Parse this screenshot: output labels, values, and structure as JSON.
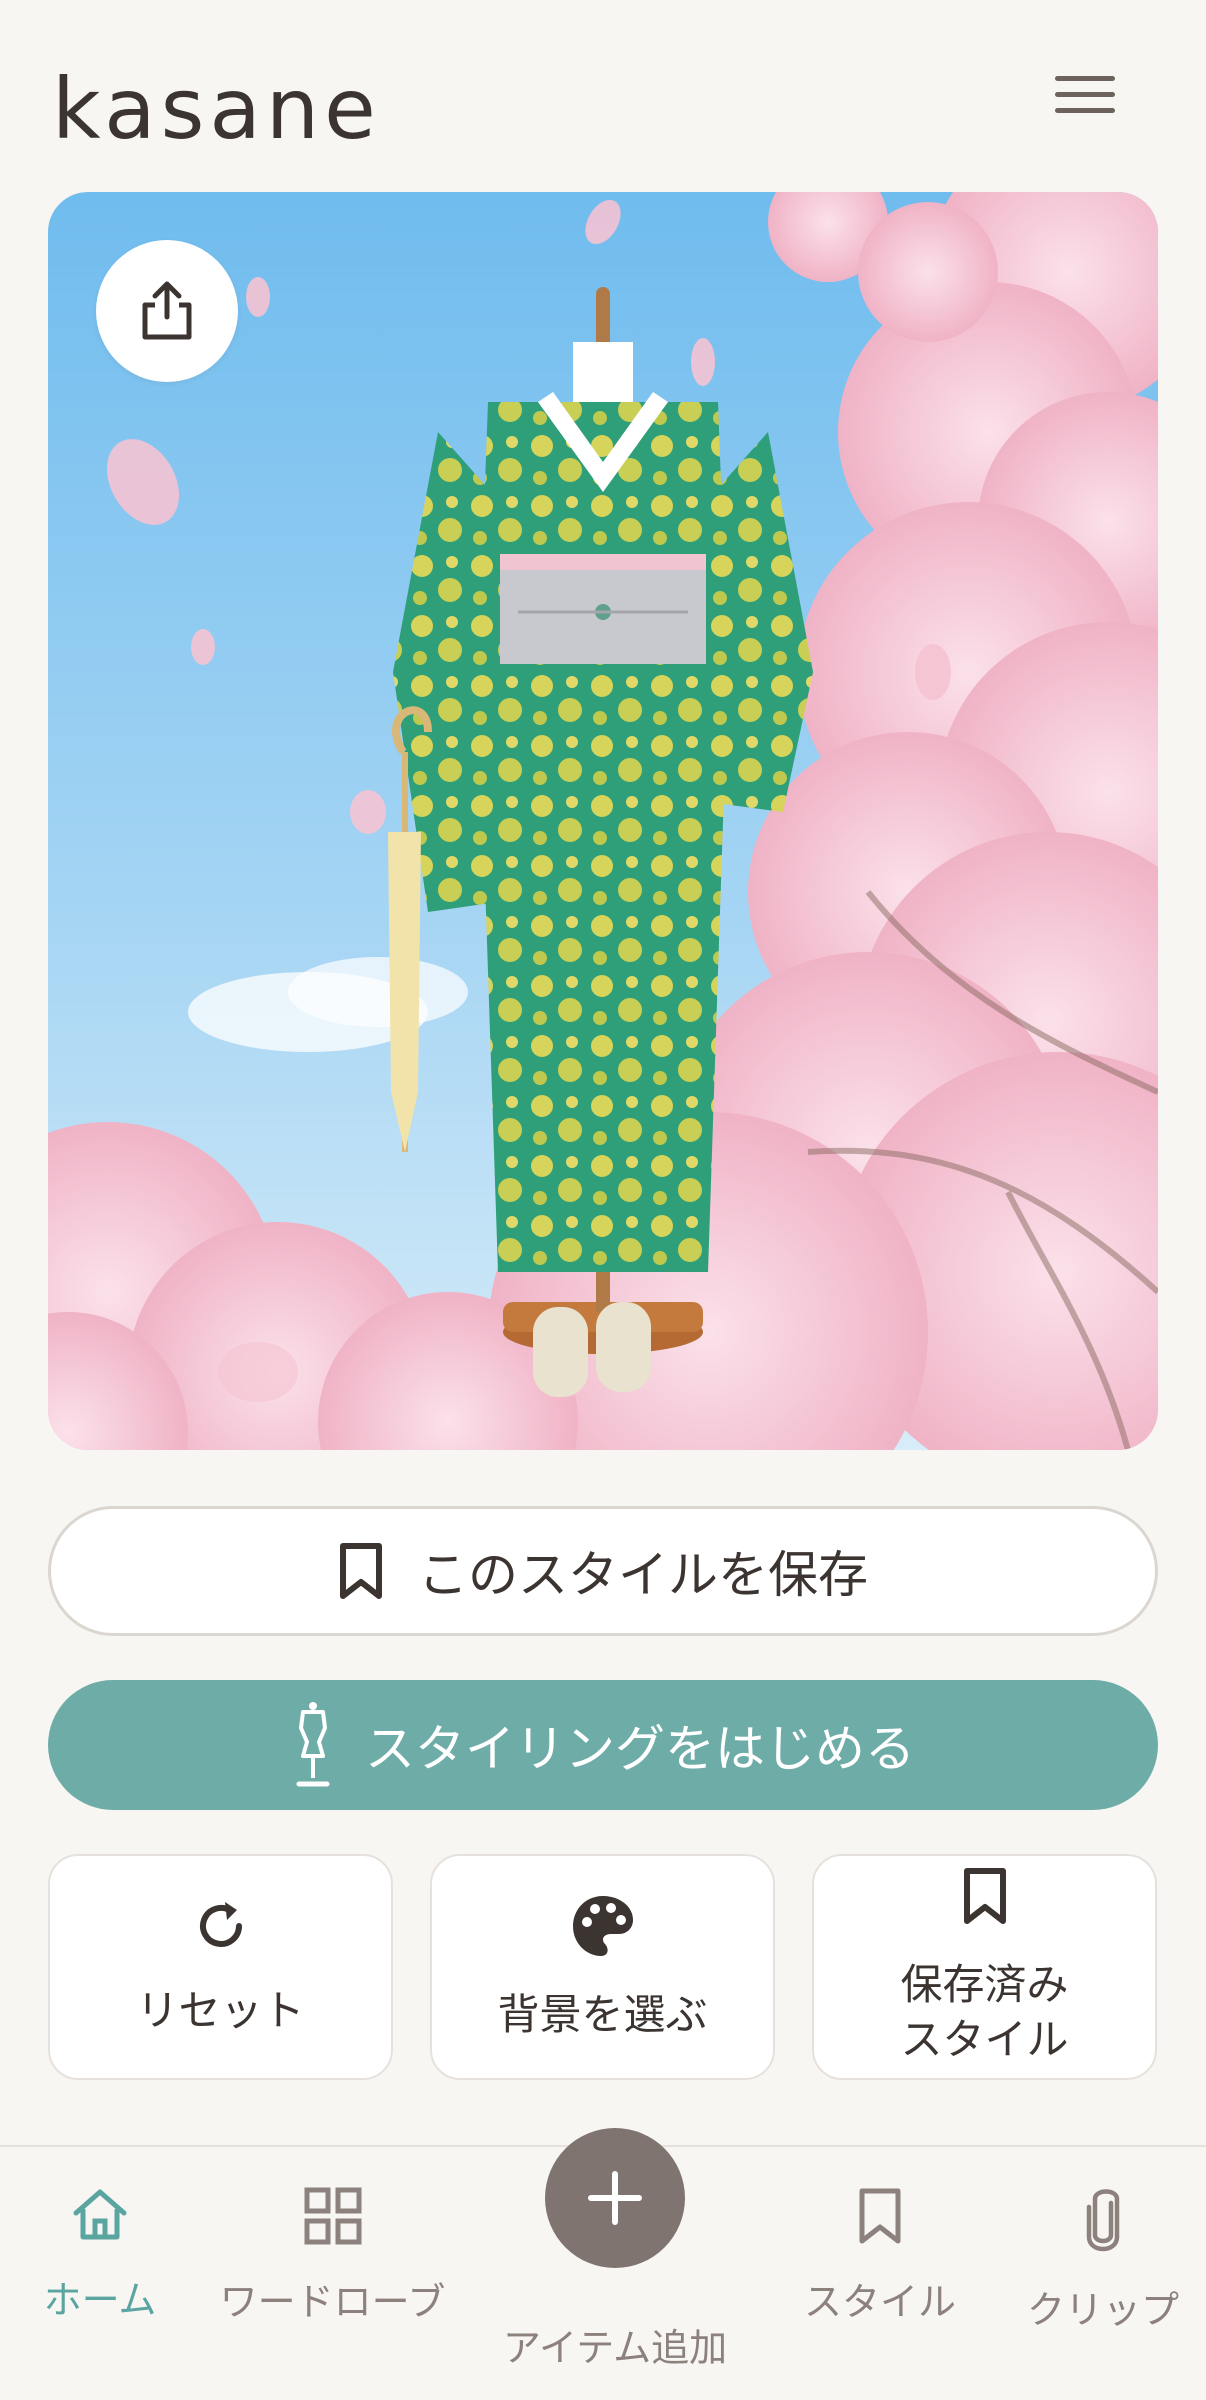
{
  "app": {
    "title": "kasane"
  },
  "header": {
    "menu_icon": "menu-icon"
  },
  "hero": {
    "share_icon": "share-icon",
    "colors": {
      "sky_top": "#7fc4ef",
      "sky_bottom": "#c9e6f7",
      "blossom": "#f3bfd0",
      "kimono": "#2fa27a",
      "kimono_pattern": "#d8d35a",
      "obi": "#c9c9cf"
    }
  },
  "actions": {
    "save_style_label": "このスタイルを保存",
    "start_styling_label": "スタイリングをはじめる",
    "accent_color": "#6eaca8"
  },
  "cards": {
    "reset_label": "リセット",
    "background_label": "背景を選ぶ",
    "saved_line1": "保存済み",
    "saved_line2": "スタイル"
  },
  "nav": {
    "home": "ホーム",
    "wardrobe": "ワードローブ",
    "add_item": "アイテム追加",
    "style": "スタイル",
    "clip": "クリップ",
    "active": "ホーム",
    "active_color": "#5aa5a0"
  }
}
